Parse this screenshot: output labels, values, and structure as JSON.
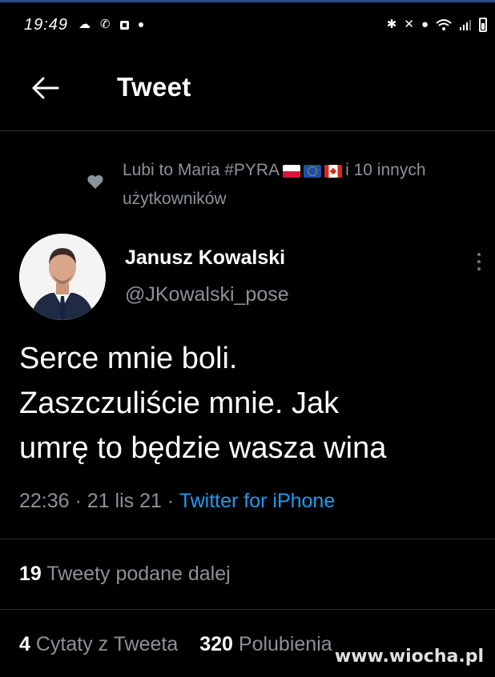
{
  "status_bar": {
    "time": "19:49",
    "left_icons": [
      "weather-icon",
      "missed-call-icon",
      "app-notification-icon",
      "dot-icon"
    ],
    "right_icons": [
      "bluetooth-icon",
      "mute-icon",
      "location-icon",
      "wifi-icon",
      "signal-icon",
      "battery-icon"
    ]
  },
  "header": {
    "title": "Tweet",
    "back_icon": "arrow-left-icon"
  },
  "social_context": {
    "text_before_flags": "Lubi to Maria #PYRA",
    "flags": [
      "Poland",
      "European Union",
      "Canada"
    ],
    "text_after_flags": "i 10 innych użytkowników",
    "icon": "heart-icon"
  },
  "tweet": {
    "author_name": "Janusz Kowalski",
    "author_handle": "@JKowalski_pose",
    "lines": [
      "Serce mnie boli.",
      "Zaszczuliście mnie. Jak",
      "umrę to będzie wasza wina"
    ],
    "time": "22:36",
    "separator": "·",
    "date": "21 lis 21",
    "source": "Twitter for iPhone"
  },
  "stats": {
    "retweets_count": "19",
    "retweets_label": "Tweety podane dalej",
    "quotes_count": "4",
    "quotes_label": "Cytaty z Tweeta",
    "likes_count": "320",
    "likes_label": "Polubienia"
  },
  "watermark": "www.wiocha.pl",
  "colors": {
    "background": "#000000",
    "link": "#1d9bf0",
    "muted": "#8b9298",
    "divider": "#2a2d30"
  }
}
